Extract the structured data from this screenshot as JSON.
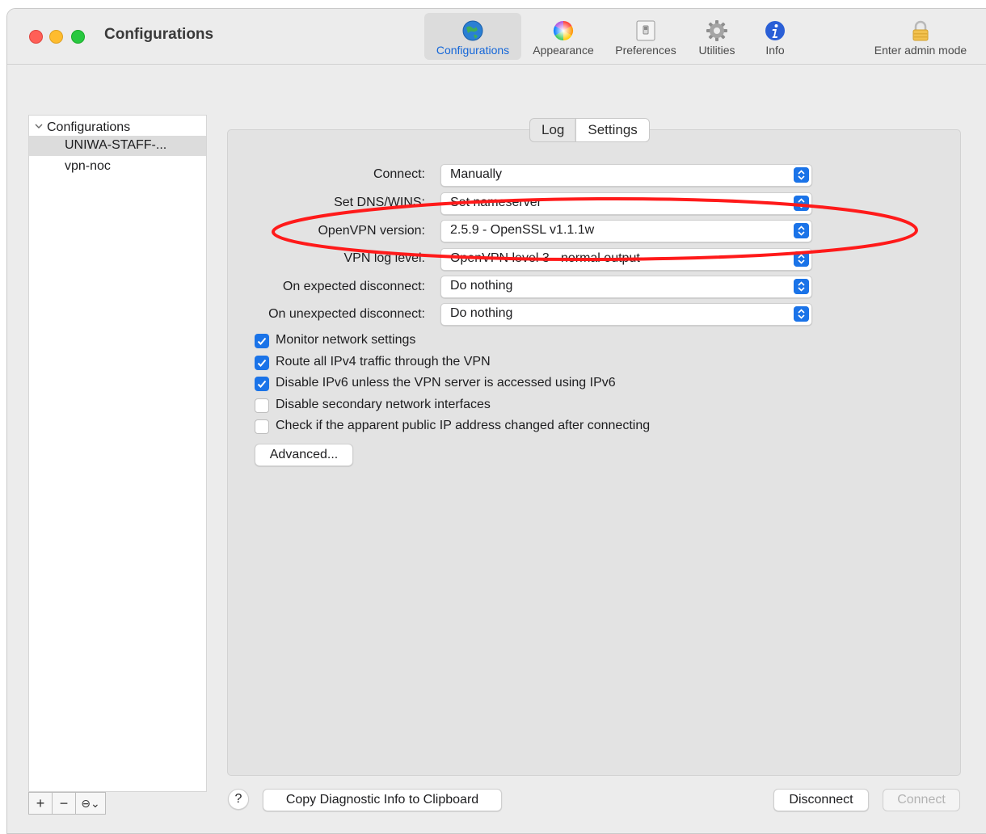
{
  "window": {
    "title": "Configurations"
  },
  "toolbar": {
    "items": [
      {
        "label": "Configurations",
        "icon": "globe-icon",
        "active": true
      },
      {
        "label": "Appearance",
        "icon": "color-wheel-icon"
      },
      {
        "label": "Preferences",
        "icon": "switch-icon"
      },
      {
        "label": "Utilities",
        "icon": "gear-icon"
      },
      {
        "label": "Info",
        "icon": "info-icon"
      }
    ],
    "admin": {
      "label": "Enter admin mode",
      "icon": "lock-icon"
    }
  },
  "sidebar": {
    "group_label": "Configurations",
    "items": [
      {
        "label": "UNIWA-STAFF-...",
        "selected": true
      },
      {
        "label": "vpn-noc"
      }
    ],
    "tools": {
      "add": "+",
      "remove": "−",
      "action": "⊖⌄"
    }
  },
  "tabs": {
    "log": "Log",
    "settings": "Settings"
  },
  "settings": {
    "rows": [
      {
        "label": "Connect:",
        "value": "Manually"
      },
      {
        "label": "Set DNS/WINS:",
        "value": "Set nameserver"
      },
      {
        "label": "OpenVPN version:",
        "value": "2.5.9 - OpenSSL v1.1.1w"
      },
      {
        "label": "VPN log level:",
        "value": "OpenVPN level 3 - normal output"
      },
      {
        "label": "On expected disconnect:",
        "value": "Do nothing"
      },
      {
        "label": "On unexpected disconnect:",
        "value": "Do nothing"
      }
    ],
    "checkboxes": [
      {
        "label": "Monitor network settings",
        "checked": true
      },
      {
        "label": "Route all IPv4 traffic through the VPN",
        "checked": true
      },
      {
        "label": "Disable IPv6 unless the VPN server is accessed using IPv6",
        "checked": true
      },
      {
        "label": "Disable secondary network interfaces",
        "checked": false
      },
      {
        "label": "Check if the apparent public IP address changed after connecting",
        "checked": false
      }
    ],
    "advanced_label": "Advanced..."
  },
  "footer": {
    "help": "?",
    "copy_diag": "Copy Diagnostic Info to Clipboard",
    "disconnect": "Disconnect",
    "connect": "Connect"
  },
  "colors": {
    "accent": "#1a73e8",
    "annotation": "#ff1a1a"
  }
}
